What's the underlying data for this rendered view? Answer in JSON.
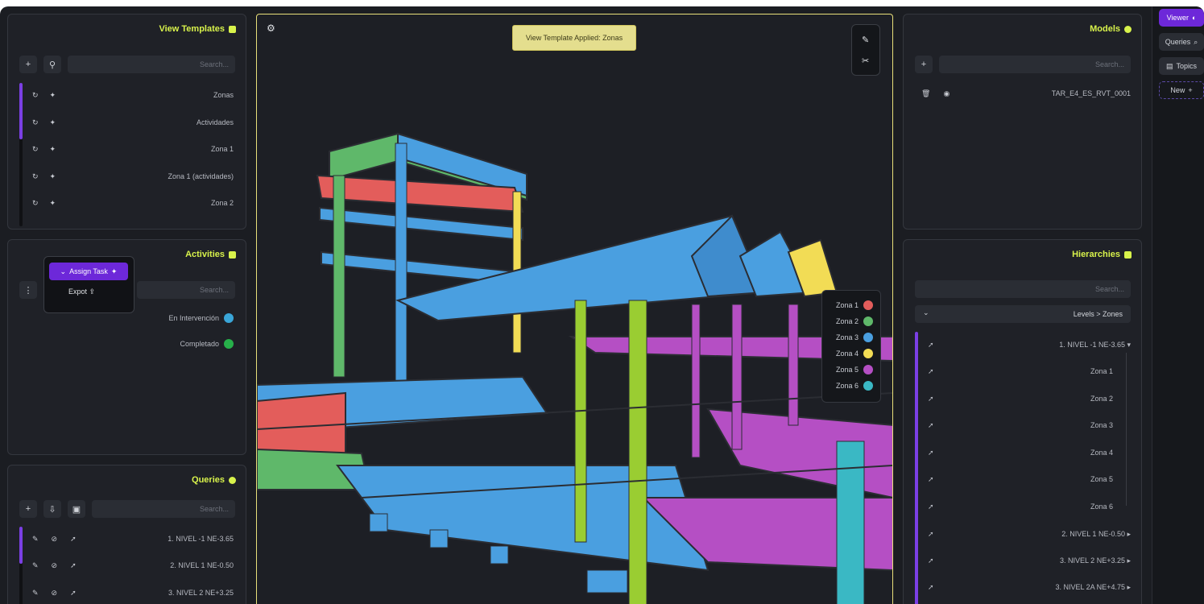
{
  "view_templates": {
    "title": "View Templates",
    "search_placeholder": "Search...",
    "items": [
      "Zonas",
      "Actividades",
      "Zona 1",
      "Zona 1 (actividades)",
      "Zona 2"
    ]
  },
  "activities": {
    "title": "Activities",
    "search_placeholder": "Search...",
    "menu": {
      "assign_label": "Assign Task",
      "export_label": "Expot"
    },
    "statuses": [
      {
        "label": "En Intervención",
        "color": "#3aa6d8"
      },
      {
        "label": "Completado",
        "color": "#27b04a"
      }
    ]
  },
  "queries": {
    "title": "Queries",
    "search_placeholder": "Search...",
    "items": [
      "1. NIVEL -1 NE-3.65",
      "2. NIVEL 1 NE-0.50",
      "3. NIVEL 2 NE+3.25"
    ]
  },
  "viewer": {
    "banner": "View Template Applied: Zonas",
    "legend": [
      {
        "label": "Zona 1",
        "color": "#e35d5b"
      },
      {
        "label": "Zona 2",
        "color": "#5fb86a"
      },
      {
        "label": "Zona 3",
        "color": "#4a9fe0"
      },
      {
        "label": "Zona 4",
        "color": "#f2dc55"
      },
      {
        "label": "Zona 5",
        "color": "#b54fc4"
      },
      {
        "label": "Zona 6",
        "color": "#3ab8c4"
      }
    ]
  },
  "models": {
    "title": "Models",
    "search_placeholder": "Search...",
    "items": [
      "TAR_E4_ES_RVT_0001"
    ]
  },
  "hierarchies": {
    "title": "Hierarchies",
    "search_placeholder": "Search...",
    "selected": "Levels > Zones",
    "root": "1. NIVEL -1 NE-3.65",
    "children": [
      "Zona 1",
      "Zona 2",
      "Zona 3",
      "Zona 4",
      "Zona 5",
      "Zona 6"
    ],
    "others": [
      "2. NIVEL 1 NE-0.50",
      "3. NIVEL 2 NE+3.25",
      "3. NIVEL 2A NE+4.75"
    ]
  },
  "tabs": {
    "viewer": "Viewer",
    "queries": "Queries",
    "topics": "Topics",
    "new": "New"
  }
}
